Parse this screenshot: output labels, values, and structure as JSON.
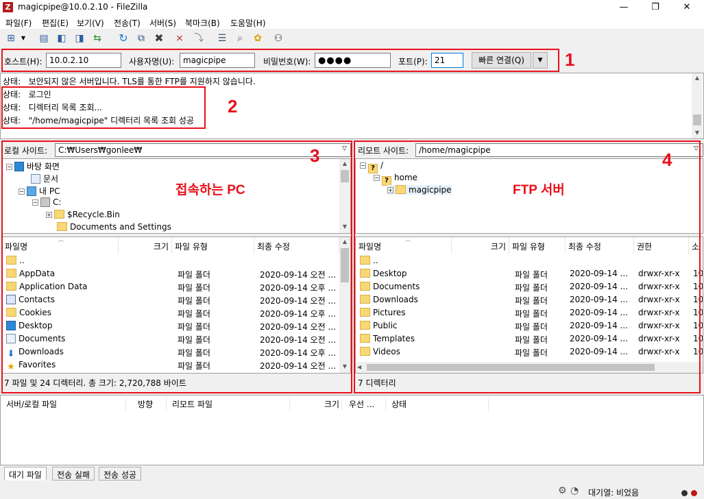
{
  "window": {
    "title": "magicpipe@10.0.2.10 - FileZilla",
    "app_icon": "Z"
  },
  "menu": [
    "파일(F)",
    "편집(E)",
    "보기(V)",
    "전송(T)",
    "서버(S)",
    "북마크(B)",
    "도움말(H)"
  ],
  "quickconnect": {
    "host_label": "호스트(H):",
    "host": "10.0.2.10",
    "user_label": "사용자명(U):",
    "user": "magicpipe",
    "pass_label": "비밀번호(W):",
    "pass": "●●●●",
    "port_label": "포트(P):",
    "port": "21",
    "button": "빠른 연결(Q)"
  },
  "log": [
    {
      "label": "상태:",
      "text": "보안되지 않은 서버입니다. TLS를 통한 FTP를 지원하지 않습니다."
    },
    {
      "label": "상태:",
      "text": "로그인"
    },
    {
      "label": "상태:",
      "text": "디렉터리 목록 조회..."
    },
    {
      "label": "상태:",
      "text": "\"/home/magicpipe\" 디렉터리 목록 조회 성공"
    }
  ],
  "annotations": {
    "n1": "1",
    "n2": "2",
    "n3": "3",
    "n4": "4",
    "local_caption": "접속하는 PC",
    "remote_caption": "FTP 서버"
  },
  "local": {
    "site_label": "로컬 사이트:",
    "site_path": "C:₩Users₩gonlee₩",
    "tree": [
      "바탕 화면",
      "문서",
      "내 PC",
      "C:",
      "$Recycle.Bin",
      "Documents and Settings"
    ],
    "headers": [
      "파일명",
      "크기",
      "파일 유형",
      "최종 수정"
    ],
    "files": [
      {
        "name": "..",
        "type": "",
        "date": ""
      },
      {
        "name": "AppData",
        "type": "파일 폴더",
        "date": "2020-09-14 오전 ..."
      },
      {
        "name": "Application Data",
        "type": "파일 폴더",
        "date": "2020-09-14 오후 ..."
      },
      {
        "name": "Contacts",
        "type": "파일 폴더",
        "date": "2020-09-14 오전 ..."
      },
      {
        "name": "Cookies",
        "type": "파일 폴더",
        "date": "2020-09-14 오후 ..."
      },
      {
        "name": "Desktop",
        "type": "파일 폴더",
        "date": "2020-09-14 오전 ..."
      },
      {
        "name": "Documents",
        "type": "파일 폴더",
        "date": "2020-09-14 오전 ..."
      },
      {
        "name": "Downloads",
        "type": "파일 폴더",
        "date": "2020-09-14 오후 ..."
      },
      {
        "name": "Favorites",
        "type": "파일 폴더",
        "date": "2020-09-14 오전 ..."
      }
    ],
    "status": "7 파일 및 24 디렉터리. 총 크기: 2,720,788 바이트"
  },
  "remote": {
    "site_label": "리모트 사이트:",
    "site_path": "/home/magicpipe",
    "tree": [
      "/",
      "home",
      "magicpipe"
    ],
    "headers": [
      "파일명",
      "크기",
      "파일 유형",
      "최종 수정",
      "권한",
      "소"
    ],
    "files": [
      {
        "name": "..",
        "type": "",
        "date": "",
        "perm": "",
        "own": ""
      },
      {
        "name": "Desktop",
        "type": "파일 폴더",
        "date": "2020-09-14 ...",
        "perm": "drwxr-xr-x",
        "own": "10"
      },
      {
        "name": "Documents",
        "type": "파일 폴더",
        "date": "2020-09-14 ...",
        "perm": "drwxr-xr-x",
        "own": "10"
      },
      {
        "name": "Downloads",
        "type": "파일 폴더",
        "date": "2020-09-14 ...",
        "perm": "drwxr-xr-x",
        "own": "10"
      },
      {
        "name": "Pictures",
        "type": "파일 폴더",
        "date": "2020-09-14 ...",
        "perm": "drwxr-xr-x",
        "own": "10"
      },
      {
        "name": "Public",
        "type": "파일 폴더",
        "date": "2020-09-14 ...",
        "perm": "drwxr-xr-x",
        "own": "10"
      },
      {
        "name": "Templates",
        "type": "파일 폴더",
        "date": "2020-09-14 ...",
        "perm": "drwxr-xr-x",
        "own": "10"
      },
      {
        "name": "Videos",
        "type": "파일 폴더",
        "date": "2020-09-14 ...",
        "perm": "drwxr-xr-x",
        "own": "10"
      }
    ],
    "status": "7 디렉터리"
  },
  "queue": {
    "headers": [
      "서버/로컬 파일",
      "방향",
      "리모트 파일",
      "크기",
      "우선 ...",
      "상태"
    ]
  },
  "tabs": [
    "대기 파일",
    "전송 실패",
    "전송 성공"
  ],
  "statusbar": {
    "queue": "대기열: 비었음"
  },
  "colors": {
    "annotation": "#e8101a",
    "folder": "#f8d775"
  }
}
